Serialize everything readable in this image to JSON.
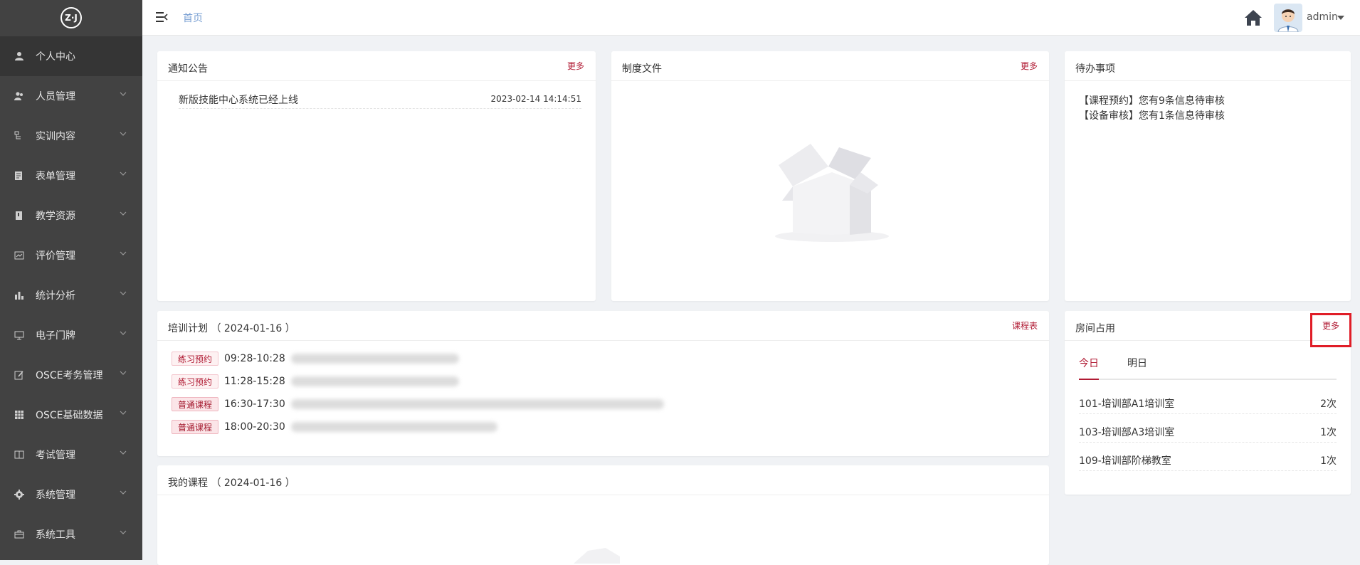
{
  "logo": {
    "text": "Z·J",
    "icon": "logo-icon"
  },
  "sidebar": {
    "items": [
      {
        "label": "个人中心",
        "icon": "user-icon",
        "expandable": false
      },
      {
        "label": "人员管理",
        "icon": "users-icon",
        "expandable": true
      },
      {
        "label": "实训内容",
        "icon": "tree-icon",
        "expandable": true
      },
      {
        "label": "表单管理",
        "icon": "form-icon",
        "expandable": true
      },
      {
        "label": "教学资源",
        "icon": "book-icon",
        "expandable": true
      },
      {
        "label": "评价管理",
        "icon": "rating-icon",
        "expandable": true
      },
      {
        "label": "统计分析",
        "icon": "bar-chart-icon",
        "expandable": true
      },
      {
        "label": "电子门牌",
        "icon": "monitor-icon",
        "expandable": true
      },
      {
        "label": "OSCE考务管理",
        "icon": "edit-icon",
        "expandable": true
      },
      {
        "label": "OSCE基础数据",
        "icon": "grid-icon",
        "expandable": true
      },
      {
        "label": "考试管理",
        "icon": "columns-icon",
        "expandable": true
      },
      {
        "label": "系统管理",
        "icon": "gear-icon",
        "expandable": true
      },
      {
        "label": "系统工具",
        "icon": "toolbox-icon",
        "expandable": true
      }
    ]
  },
  "header": {
    "breadcrumb": "首页",
    "user_name": "admin"
  },
  "notice": {
    "title": "通知公告",
    "more": "更多",
    "items": [
      {
        "text": "新版技能中心系统已经上线",
        "date": "2023-02-14 14:14:51"
      }
    ]
  },
  "policy": {
    "title": "制度文件",
    "more": "更多"
  },
  "todo": {
    "title": "待办事项",
    "items": [
      "【课程预约】您有9条信息待审核",
      "【设备审核】您有1条信息待审核"
    ]
  },
  "plan": {
    "title": "培训计划  （ 2024-01-16 ）",
    "more": "课程表",
    "rows": [
      {
        "tag": "练习预约",
        "time": "09:28-10:28",
        "style": "light"
      },
      {
        "tag": "练习预约",
        "time": "11:28-15:28",
        "style": "light"
      },
      {
        "tag": "普通课程",
        "time": "16:30-17:30",
        "style": "solid"
      },
      {
        "tag": "普通课程",
        "time": "18:00-20:30",
        "style": "solid"
      }
    ]
  },
  "room": {
    "title": "房间占用",
    "more": "更多",
    "tabs": [
      "今日",
      "明日"
    ],
    "rows": [
      {
        "name": "101-培训部A1培训室",
        "count": "2次"
      },
      {
        "name": "103-培训部A3培训室",
        "count": "1次"
      },
      {
        "name": "109-培训部阶梯教室",
        "count": "1次"
      }
    ]
  },
  "courses": {
    "title": "我的课程  （ 2024-01-16 ）"
  },
  "colors": {
    "accent": "#b01a33",
    "sidebar": "#424242",
    "highlight": "#e01d27"
  }
}
